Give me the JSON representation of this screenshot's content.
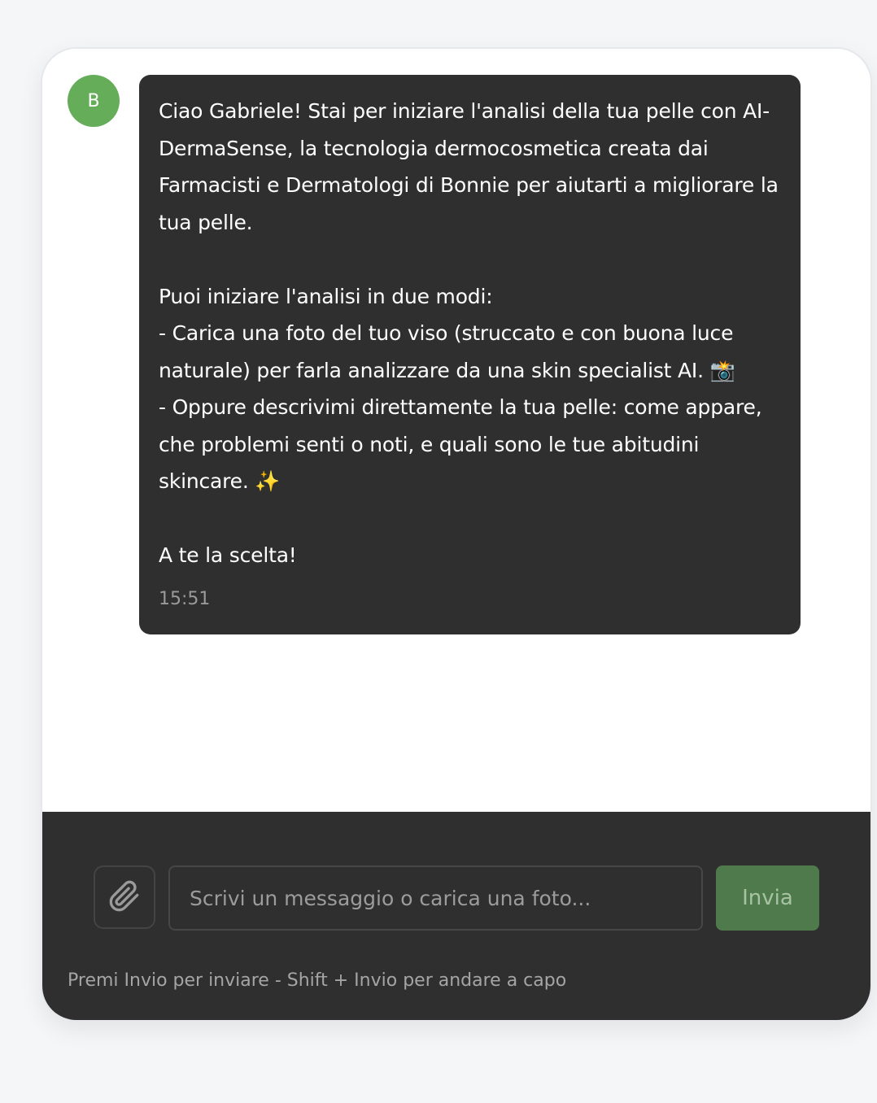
{
  "assistant": {
    "avatar_letter": "B",
    "avatar_color": "#66ad5a"
  },
  "message": {
    "text": "Ciao Gabriele! Stai per iniziare l'analisi della tua pelle con AI-DermaSense, la tecnologia dermocosmetica creata dai Farmacisti e Dermatologi di Bonnie per aiutarti a migliorare la tua pelle.\n\nPuoi iniziare l'analisi in due modi:\n- Carica una foto del tuo viso (struccato e con buona luce naturale) per farla analizzare da una skin specialist AI. 📸\n- Oppure descrivimi direttamente la tua pelle: come appare, che problemi senti o noti, e quali sono le tue abitudini skincare. ✨\n\nA te la scelta!",
    "time": "15:51"
  },
  "composer": {
    "attach_icon": "paperclip-icon",
    "placeholder": "Scrivi un messaggio o carica una foto...",
    "value": "",
    "send_label": "Invia",
    "hint": "Premi Invio per inviare - Shift + Invio per andare a capo"
  },
  "colors": {
    "bubble_bg": "#2f2f2f",
    "composer_bg": "#2f2f2f",
    "send_button": "#4f7a4c",
    "page_bg": "#f5f6f8"
  }
}
